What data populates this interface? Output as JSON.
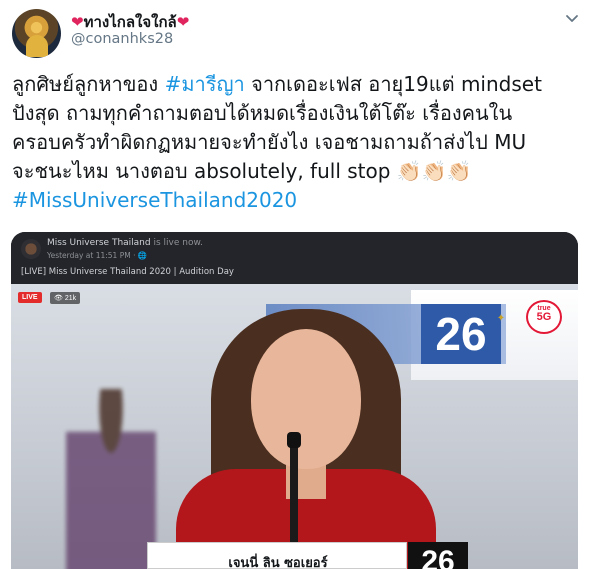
{
  "tweet": {
    "display_name": "ทางไกลใจใกล้",
    "handle": "@conanhks28",
    "text_lines": [
      [
        {
          "t": "ลูกศิษย์ลูกหาของ ",
          "tag": false
        },
        {
          "t": "#มารีญา",
          "tag": true
        },
        {
          "t": " จากเดอะเฟส อายุ19แต่ mindset",
          "tag": false
        }
      ],
      [
        {
          "t": "ปังสุด  ถามทุกคำถามตอบได้หมดเรื่องเงินใต้โต๊ะ เรื่องคนใน",
          "tag": false
        }
      ],
      [
        {
          "t": "ครอบครัวทำผิดกฏหมายจะทำยังไง เจอชามถามถ้าส่งไป MU",
          "tag": false
        }
      ],
      [
        {
          "t": "จะชนะไหม นางตอบ absolutely, full stop 👏🏻👏🏻👏🏻",
          "tag": false
        }
      ],
      [
        {
          "t": "#MissUniverseThailand2020",
          "tag": true
        }
      ]
    ]
  },
  "media": {
    "page_name": "Miss Universe Thailand",
    "page_status": " is live now.",
    "posted_time": "Yesterday at 11:51 PM · 🌐",
    "video_title": "[LIVE] Miss Universe Thailand 2020 | Audition Day",
    "live_label": "LIVE",
    "viewer_count": "👁 21k",
    "stage_number": "26",
    "sponsor_top": "true",
    "sponsor_bottom": "5G",
    "contestant_name": "เจนนี่ ลิน ซอเยอร์",
    "contestant_number": "26"
  },
  "icons": {
    "heart": "heart-icon",
    "chevron": "chevron-down-icon"
  },
  "colors": {
    "hashtag": "#1b95e0",
    "heart": "#e0245e",
    "live": "#e42b2b"
  }
}
